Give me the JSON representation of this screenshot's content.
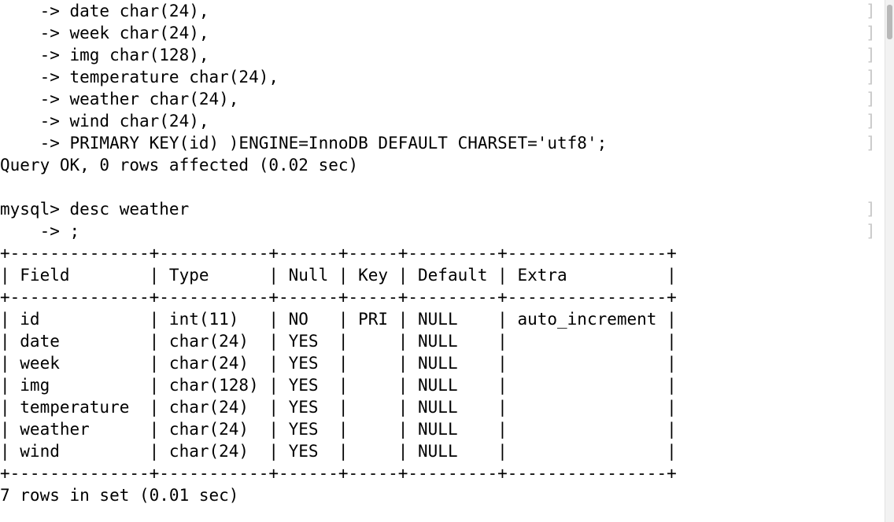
{
  "terminal": {
    "prompt": "mysql>",
    "continuation": "    ->",
    "background_color": "#ffffff",
    "text_color": "#000000",
    "gutter_color": "#c9c9c9",
    "scrollbar_color": "#b8b8b8",
    "lines": [
      "    -> date char(24),",
      "    -> week char(24),",
      "    -> img char(128),",
      "    -> temperature char(24),",
      "    -> weather char(24),",
      "    -> wind char(24),",
      "    -> PRIMARY KEY(id) )ENGINE=InnoDB DEFAULT CHARSET='utf8';",
      "Query OK, 0 rows affected (0.02 sec)",
      "",
      "mysql> desc weather",
      "    -> ;",
      "+--------------+-----------+------+-----+---------+----------------+",
      "| Field        | Type      | Null | Key | Default | Extra          |",
      "+--------------+-----------+------+-----+---------+----------------+",
      "| id           | int(11)   | NO   | PRI | NULL    | auto_increment |",
      "| date         | char(24)  | YES  |     | NULL    |                |",
      "| week         | char(24)  | YES  |     | NULL    |                |",
      "| img          | char(128) | YES  |     | NULL    |                |",
      "| temperature  | char(24)  | YES  |     | NULL    |                |",
      "| weather      | char(24)  | YES  |     | NULL    |                |",
      "| wind         | char(24)  | YES  |     | NULL    |                |",
      "+--------------+-----------+------+-----+---------+----------------+",
      "7 rows in set (0.01 sec)"
    ],
    "gutter_glyphs": [
      "]",
      "]",
      "]",
      "]",
      "]",
      "]",
      "]",
      "",
      "",
      "]",
      "]",
      "",
      "",
      "",
      "",
      "",
      "",
      "",
      "",
      "",
      "",
      "",
      ""
    ]
  },
  "create_table_statement": {
    "columns": [
      {
        "name": "date",
        "type": "char(24)"
      },
      {
        "name": "week",
        "type": "char(24)"
      },
      {
        "name": "img",
        "type": "char(128)"
      },
      {
        "name": "temperature",
        "type": "char(24)"
      },
      {
        "name": "weather",
        "type": "char(24)"
      },
      {
        "name": "wind",
        "type": "char(24)"
      }
    ],
    "primary_key": "PRIMARY KEY(id)",
    "engine": "InnoDB",
    "charset": "utf8",
    "result": "Query OK, 0 rows affected (0.02 sec)",
    "elapsed": "0.02 sec",
    "rows_affected": "0"
  },
  "desc_command": {
    "command": "desc weather",
    "terminator": ";",
    "table": "weather"
  },
  "desc_result": {
    "headers": [
      "Field",
      "Type",
      "Null",
      "Key",
      "Default",
      "Extra"
    ],
    "rows": [
      {
        "Field": "id",
        "Type": "int(11)",
        "Null": "NO",
        "Key": "PRI",
        "Default": "NULL",
        "Extra": "auto_increment"
      },
      {
        "Field": "date",
        "Type": "char(24)",
        "Null": "YES",
        "Key": "",
        "Default": "NULL",
        "Extra": ""
      },
      {
        "Field": "week",
        "Type": "char(24)",
        "Null": "YES",
        "Key": "",
        "Default": "NULL",
        "Extra": ""
      },
      {
        "Field": "img",
        "Type": "char(128)",
        "Null": "YES",
        "Key": "",
        "Default": "NULL",
        "Extra": ""
      },
      {
        "Field": "temperature",
        "Type": "char(24)",
        "Null": "YES",
        "Key": "",
        "Default": "NULL",
        "Extra": ""
      },
      {
        "Field": "weather",
        "Type": "char(24)",
        "Null": "YES",
        "Key": "",
        "Default": "NULL",
        "Extra": ""
      },
      {
        "Field": "wind",
        "Type": "char(24)",
        "Null": "YES",
        "Key": "",
        "Default": "NULL",
        "Extra": ""
      }
    ],
    "footer": "7 rows in set (0.01 sec)",
    "row_count": "7",
    "elapsed": "0.01 sec"
  },
  "scrollbar": {
    "orientation": "vertical",
    "position": "right"
  }
}
